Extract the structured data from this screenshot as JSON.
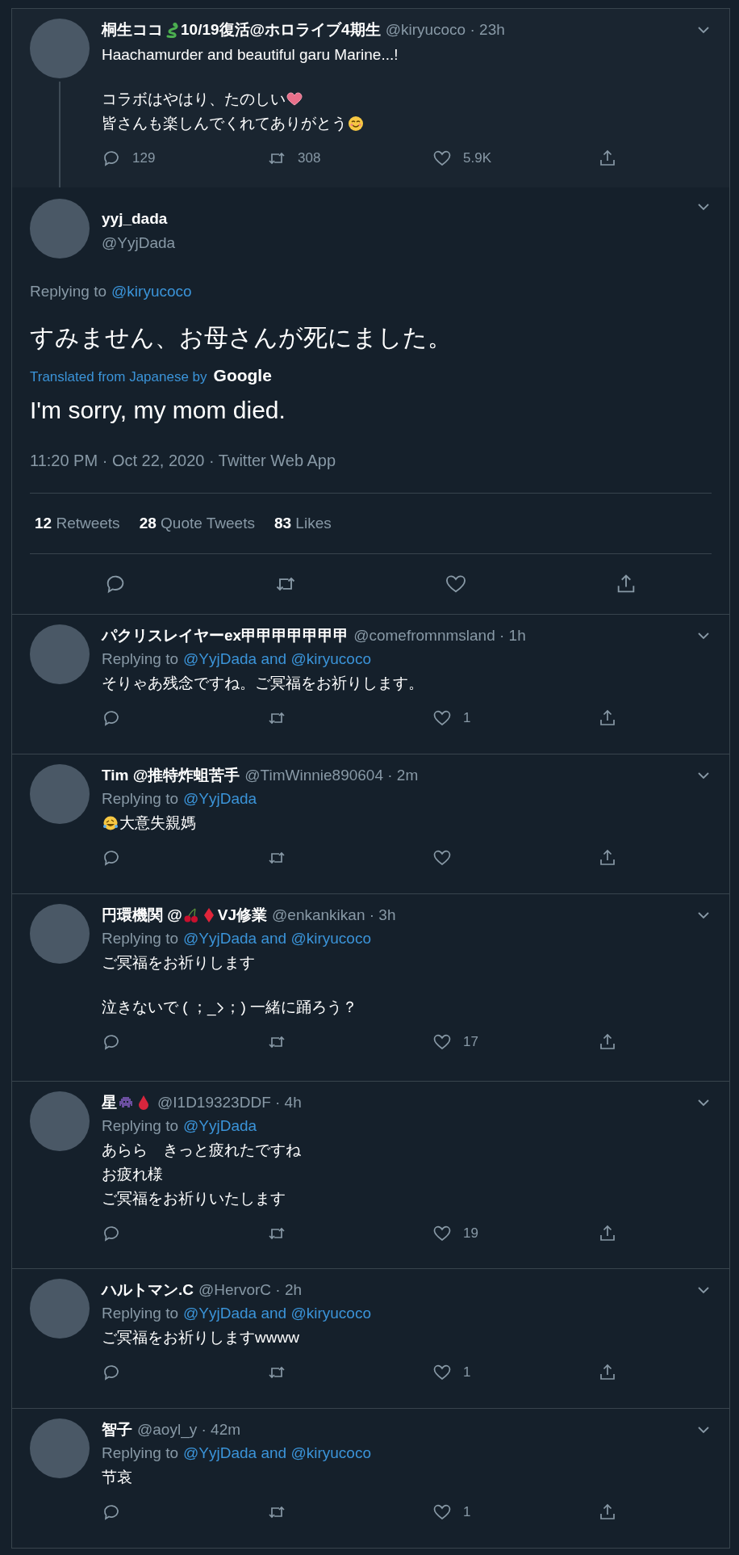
{
  "parent_tweet": {
    "name_parts": [
      {
        "kind": "text",
        "text": "桐生ココ"
      },
      {
        "kind": "snake"
      },
      {
        "kind": "text",
        "text": "10/19復活@ホロライブ4期生"
      }
    ],
    "handle_time": "@kiryucoco · 23h",
    "paragraphs": [
      {
        "lines": [
          {
            "parts": [
              {
                "kind": "text",
                "text": "Haachamurder and beautiful garu Marine...!"
              }
            ]
          }
        ]
      },
      {
        "lines": [
          {
            "parts": [
              {
                "kind": "text",
                "text": "コラボはやはり、たのしい"
              },
              {
                "kind": "heart"
              }
            ]
          },
          {
            "parts": [
              {
                "kind": "text",
                "text": "皆さんも楽しんでくれてありがとう"
              },
              {
                "kind": "smile"
              }
            ]
          }
        ]
      }
    ],
    "actions": {
      "reply": "129",
      "retweet": "308",
      "like": "5.9K"
    }
  },
  "main_tweet": {
    "name": "yyj_dada",
    "handle": "@YyjDada",
    "replying_label": "Replying to",
    "replying_link": "@kiryucoco",
    "text": "すみません、お母さんが死にました。",
    "translated_label": "Translated from Japanese by",
    "translator": "Google",
    "translation": "I'm sorry, my mom died.",
    "meta": "11:20 PM · Oct 22, 2020 · Twitter Web App",
    "stats": [
      {
        "count": "12",
        "label": "Retweets"
      },
      {
        "count": "28",
        "label": "Quote Tweets"
      },
      {
        "count": "83",
        "label": "Likes"
      }
    ]
  },
  "replies": [
    {
      "name_parts": [
        {
          "kind": "text",
          "text": "パクリスレイヤーex甲甲甲甲甲甲甲"
        }
      ],
      "handle_time": "@comefromnmsland · 1h",
      "replying_label": "Replying to",
      "replying_link": "@YyjDada and @kiryucoco",
      "paragraphs": [
        {
          "lines": [
            {
              "parts": [
                {
                  "kind": "text",
                  "text": "そりゃあ残念ですね。ご冥福をお祈りします。"
                }
              ]
            }
          ]
        }
      ],
      "actions": {
        "like": "1"
      }
    },
    {
      "name_parts": [
        {
          "kind": "text",
          "text": "Tim @推特炸蛆苦手"
        }
      ],
      "handle_time": "@TimWinnie890604 · 2m",
      "replying_label": "Replying to",
      "replying_link": "@YyjDada",
      "paragraphs": [
        {
          "lines": [
            {
              "parts": [
                {
                  "kind": "laughing"
                },
                {
                  "kind": "text",
                  "text": "大意失親媽"
                }
              ]
            }
          ]
        }
      ]
    },
    {
      "name_parts": [
        {
          "kind": "text",
          "text": "円環機関 @"
        },
        {
          "kind": "cherries"
        },
        {
          "kind": "diamond"
        },
        {
          "kind": "text",
          "text": "VJ修業"
        }
      ],
      "handle_time": "@enkankikan · 3h",
      "replying_label": "Replying to",
      "replying_link": "@YyjDada and @kiryucoco",
      "paragraphs": [
        {
          "lines": [
            {
              "parts": [
                {
                  "kind": "text",
                  "text": "ご冥福をお祈りします"
                }
              ]
            }
          ]
        },
        {
          "lines": [
            {
              "parts": [
                {
                  "kind": "text",
                  "text": "泣きないで ( ；_"
                },
                {
                  "kind": "iteration-mark"
                },
                {
                  "kind": "text",
                  "text": "；) 一緒に踊ろう？"
                }
              ]
            }
          ]
        }
      ],
      "actions": {
        "like": "17"
      }
    },
    {
      "name_parts": [
        {
          "kind": "text",
          "text": "星"
        },
        {
          "kind": "alien"
        },
        {
          "kind": "drop"
        }
      ],
      "handle_time": "@I1D19323DDF · 4h",
      "replying_label": "Replying to",
      "replying_link": "@YyjDada",
      "paragraphs": [
        {
          "lines": [
            {
              "parts": [
                {
                  "kind": "text",
                  "text": "あらら　きっと疲れたですね"
                }
              ]
            },
            {
              "parts": [
                {
                  "kind": "text",
                  "text": "お疲れ様"
                }
              ]
            },
            {
              "parts": [
                {
                  "kind": "text",
                  "text": "ご冥福をお祈りいたします"
                }
              ]
            }
          ]
        }
      ],
      "actions": {
        "like": "19"
      }
    },
    {
      "name_parts": [
        {
          "kind": "text",
          "text": "ハルトマン.C"
        }
      ],
      "handle_time": "@HervorC · 2h",
      "replying_label": "Replying to",
      "replying_link": "@YyjDada and @kiryucoco",
      "paragraphs": [
        {
          "lines": [
            {
              "parts": [
                {
                  "kind": "text",
                  "text": "ご冥福をお祈りしますwwww"
                }
              ]
            }
          ]
        }
      ],
      "actions": {
        "like": "1"
      }
    },
    {
      "name_parts": [
        {
          "kind": "text",
          "text": "智子"
        }
      ],
      "handle_time": "@aoyl_y · 42m",
      "replying_label": "Replying to",
      "replying_link": "@YyjDada and @kiryucoco",
      "paragraphs": [
        {
          "lines": [
            {
              "parts": [
                {
                  "kind": "text",
                  "text": "节哀"
                }
              ]
            }
          ]
        }
      ],
      "actions": {
        "like": "1"
      }
    }
  ]
}
